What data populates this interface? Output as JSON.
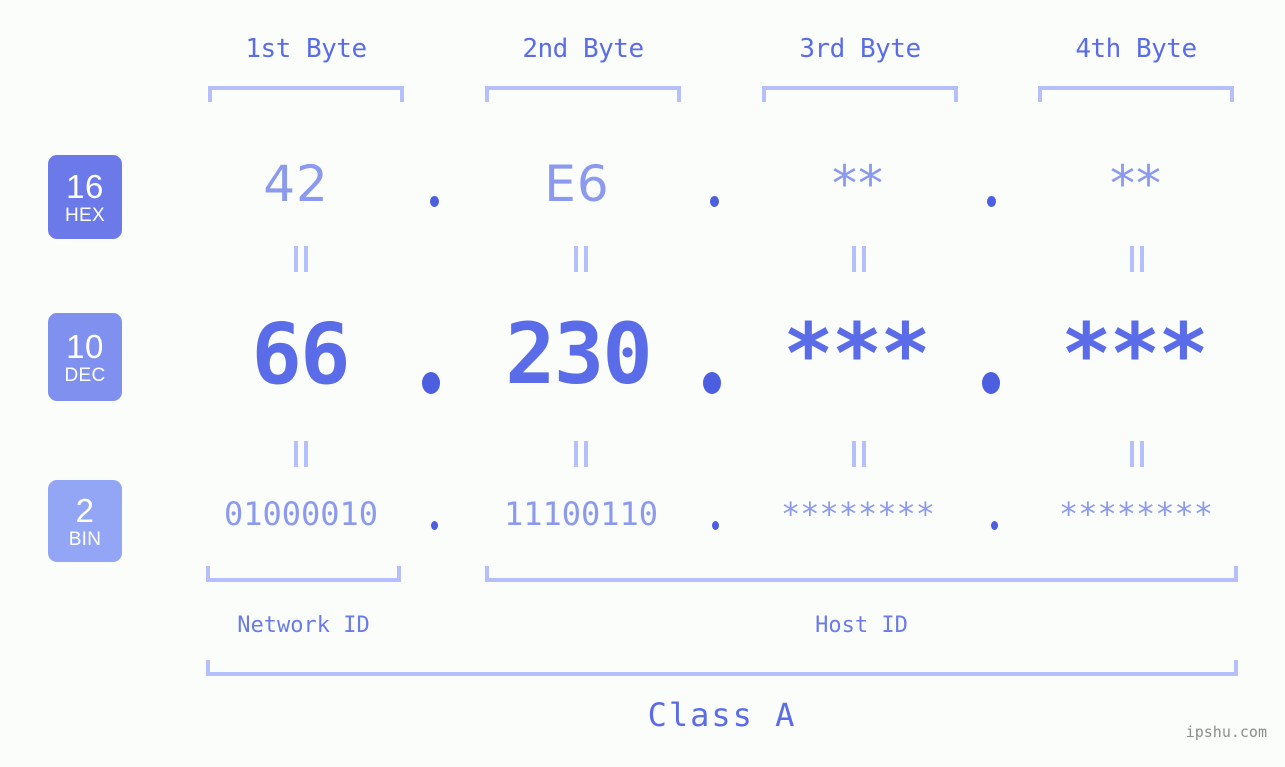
{
  "background_color": "#fafdfa",
  "accent_color": "#5b6ce8",
  "light_accent_color": "#8b9aef",
  "bracket_color": "#b4bffb",
  "byte_headers": [
    {
      "label": "1st Byte"
    },
    {
      "label": "2nd Byte"
    },
    {
      "label": "3rd Byte"
    },
    {
      "label": "4th Byte"
    }
  ],
  "rows": [
    {
      "badge_number": "16",
      "badge_name": "HEX",
      "badge_color": "#6b7ae8",
      "values": [
        "42",
        "E6",
        "**",
        "**"
      ],
      "separators": [
        ".",
        ".",
        "."
      ]
    },
    {
      "badge_number": "10",
      "badge_name": "DEC",
      "badge_color": "#8090ee",
      "values": [
        "66",
        "230",
        "***",
        "***"
      ],
      "separators": [
        ".",
        ".",
        "."
      ]
    },
    {
      "badge_number": "2",
      "badge_name": "BIN",
      "badge_color": "#92a6f5",
      "values": [
        "01000010",
        "11100110",
        "********",
        "********"
      ],
      "separators": [
        ".",
        ".",
        "."
      ]
    }
  ],
  "sections": [
    {
      "label": "Network ID"
    },
    {
      "label": "Host ID"
    }
  ],
  "class": {
    "label": "Class A"
  },
  "watermark": {
    "text": "ipshu.com"
  }
}
